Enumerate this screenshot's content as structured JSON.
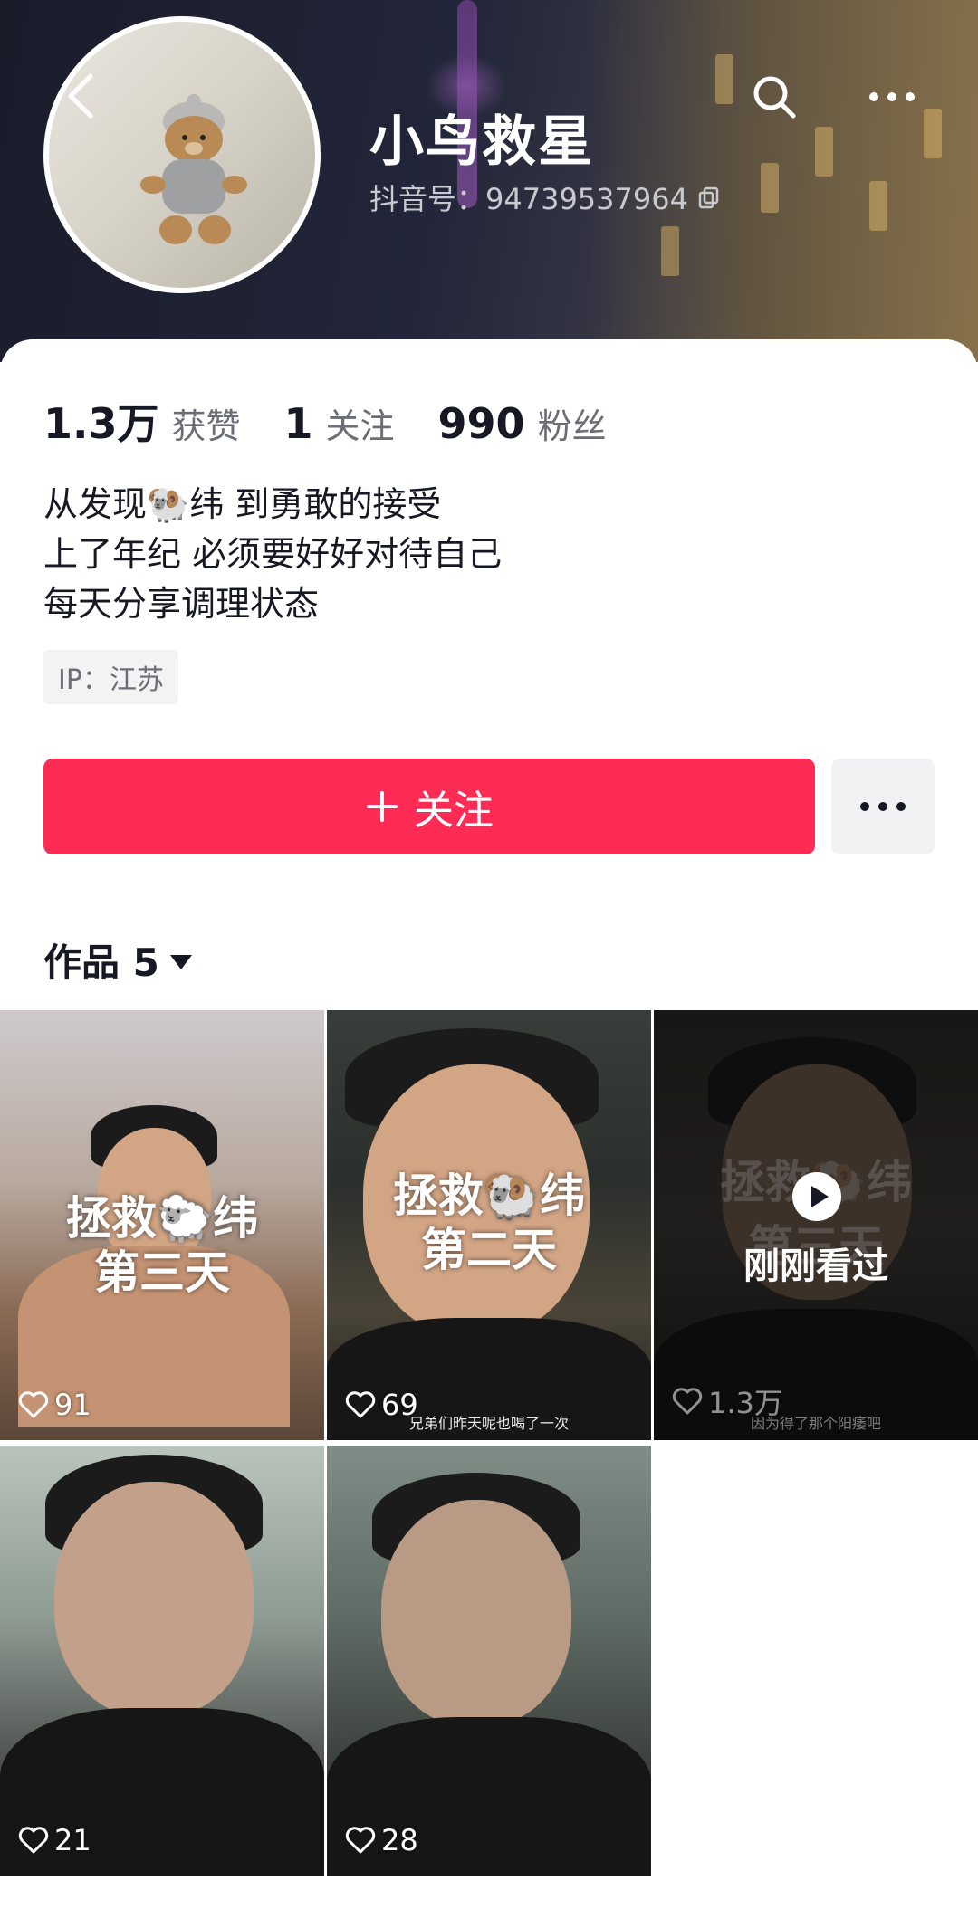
{
  "header": {
    "nickname": "小鸟救星",
    "douyin_id": "抖音号：94739537964"
  },
  "stats": [
    {
      "value": "1.3万",
      "label": "获赞"
    },
    {
      "value": "1",
      "label": "关注"
    },
    {
      "value": "990",
      "label": "粉丝"
    }
  ],
  "bio": {
    "line1": "从发现🐏纬 到勇敢的接受",
    "line2": "上了年纪 必须要好好对待自己",
    "line3": "每天分享调理状态"
  },
  "ip": "IP：江苏",
  "follow_label": "关注",
  "works_label": "作品 5",
  "videos": [
    {
      "title1": "拯救🐑纬",
      "title2": "第三天",
      "likes": "91"
    },
    {
      "title1": "拯救🐏纬",
      "title2": "第二天",
      "likes": "69",
      "subtitle": "兄弟们昨天呢也喝了一次"
    },
    {
      "title1": "拯救🐏纬",
      "title2": "第三天",
      "likes": "1.3万",
      "status": "刚刚看过",
      "subtitle": "因为得了那个阳痿吧"
    },
    {
      "likes": "21"
    },
    {
      "likes": "28"
    }
  ],
  "colors": {
    "accent": "#fe2c55"
  }
}
